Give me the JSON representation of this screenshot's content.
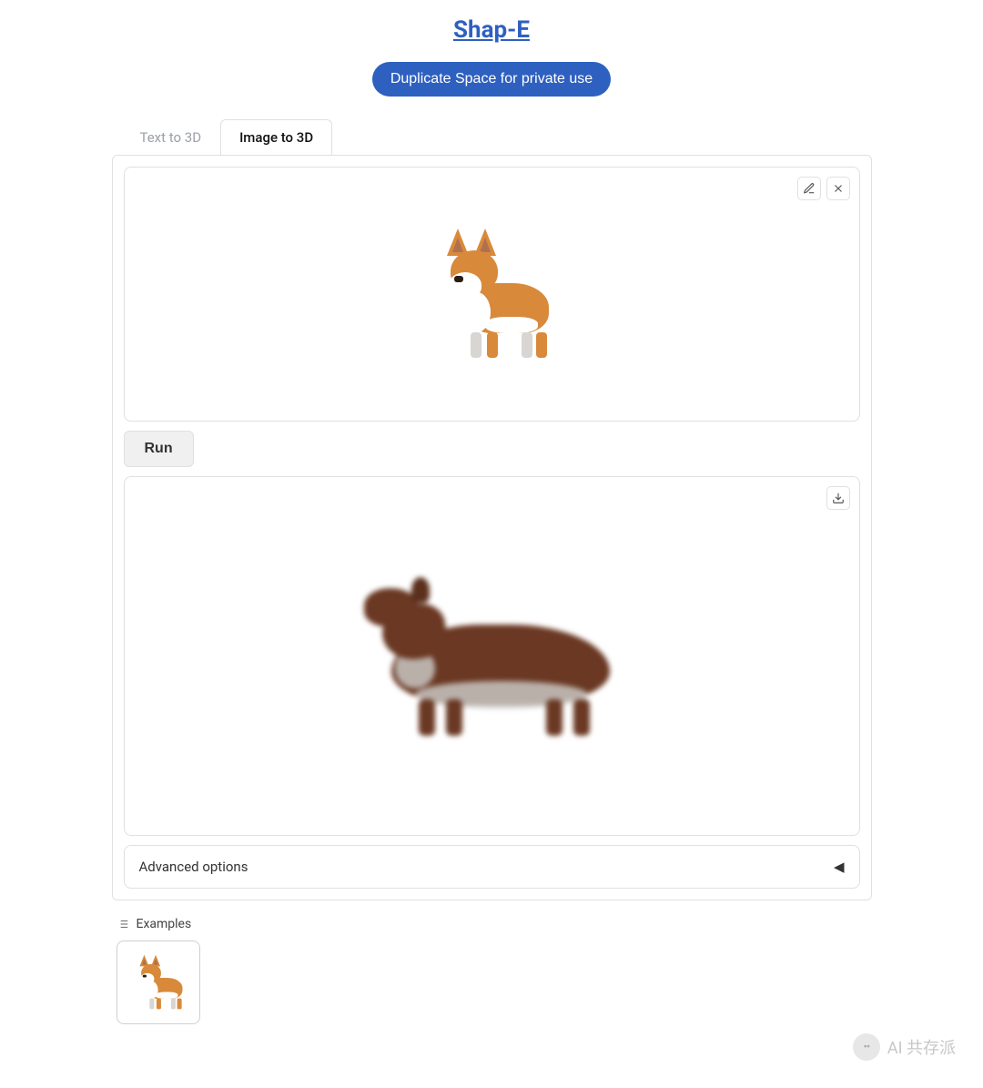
{
  "header": {
    "title": "Shap-E",
    "duplicate_button": "Duplicate Space for private use"
  },
  "tabs": [
    {
      "label": "Text to 3D",
      "active": false
    },
    {
      "label": "Image to 3D",
      "active": true
    }
  ],
  "input_panel": {
    "icons": {
      "edit": "pencil-icon",
      "clear": "close-icon"
    },
    "image_description": "corgi-dog-3d"
  },
  "run_button": "Run",
  "output_panel": {
    "icons": {
      "download": "download-icon"
    },
    "model_description": "corgi-dog-generated-3d-side"
  },
  "accordion": {
    "label": "Advanced options",
    "arrow": "◀"
  },
  "examples": {
    "label": "Examples",
    "items": [
      {
        "thumb_description": "corgi-thumbnail"
      }
    ]
  },
  "watermark": {
    "icon_text": "••",
    "text": "AI 共存派"
  }
}
